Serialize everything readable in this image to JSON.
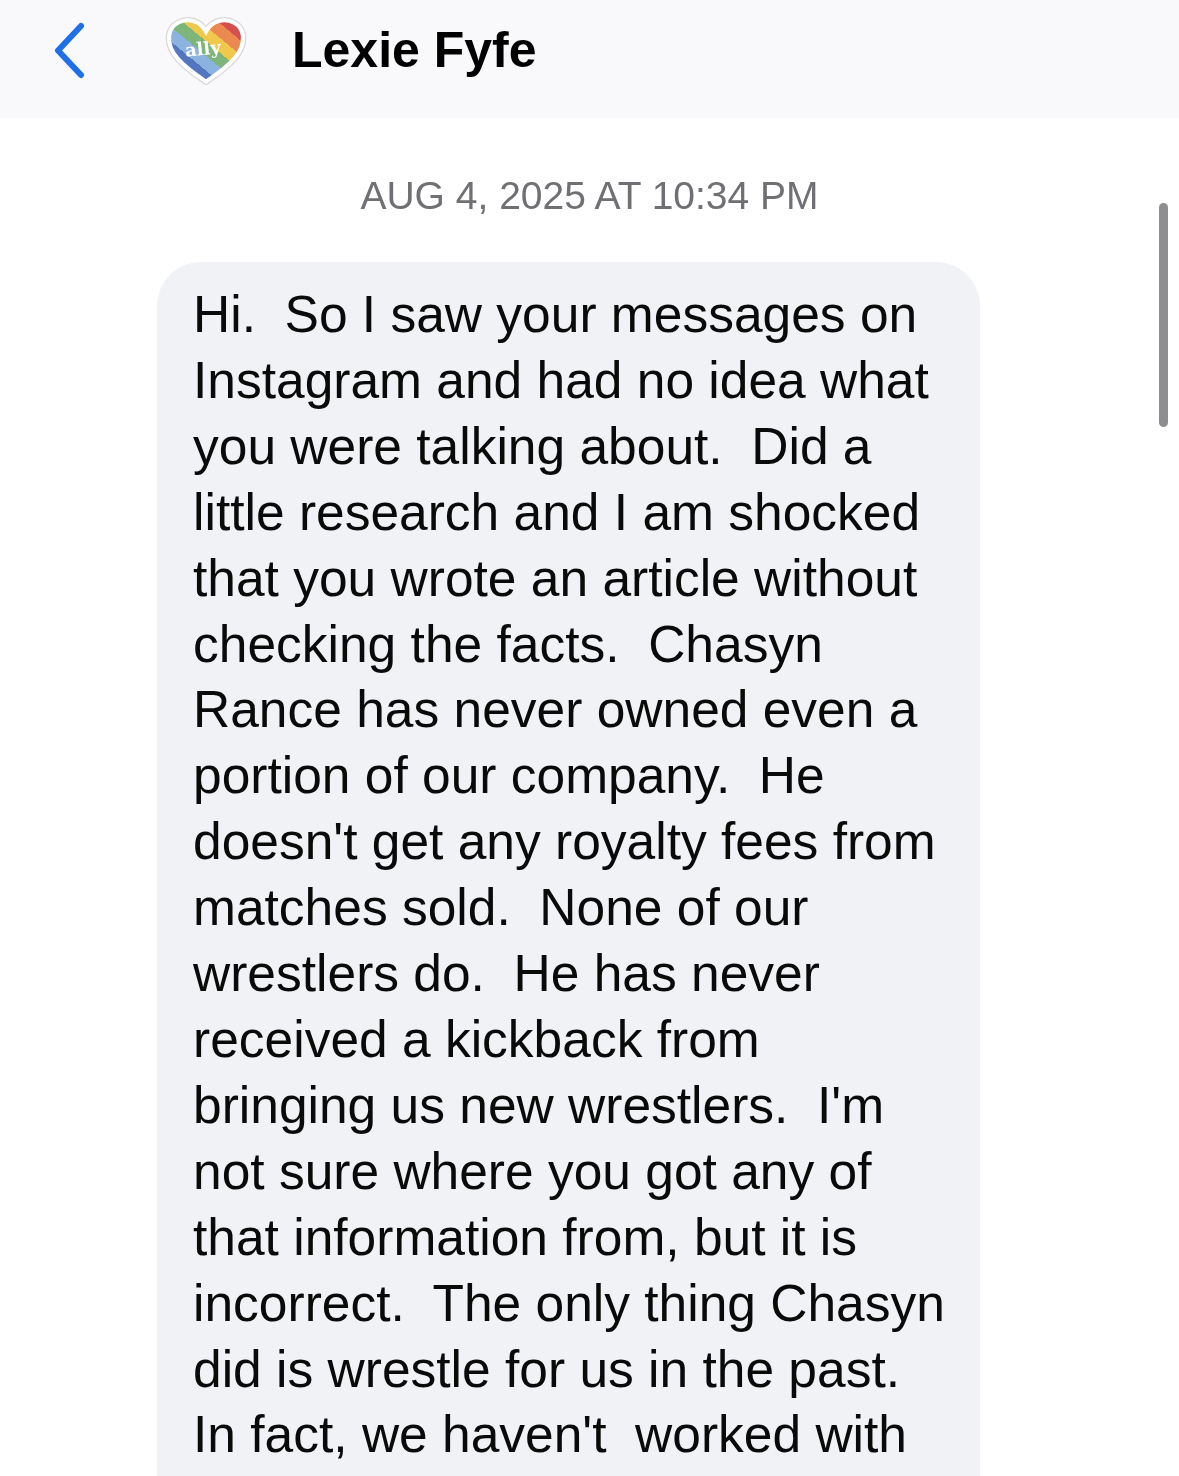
{
  "header": {
    "avatar_text": "ally",
    "contact_name": "Lexie Fyfe"
  },
  "timestamp": "AUG 4, 2025 AT 10:34 PM",
  "messages": [
    {
      "kind": "incoming",
      "text": "Hi.  So I saw your messages on Instagram and had no idea what you were talking about.  Did a little research and I am shocked that you wrote an article without checking the facts.  Chasyn Rance has never owned even a portion of our company.  He doesn't get any royalty fees from matches sold.  None of our wrestlers do.  He has never received a kickback from bringing us new wrestlers.  I'm not sure where you got any of that information from, but it is incorrect.  The only thing Chasyn did is wrestle for us in the past.  In fact, we haven't  worked with"
    }
  ]
}
